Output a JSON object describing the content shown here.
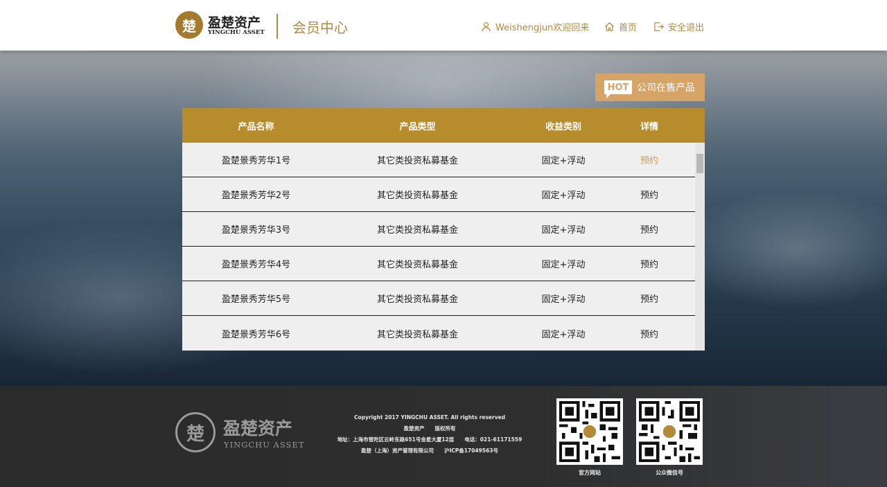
{
  "header": {
    "logo_cn": "盈楚资产",
    "logo_en": "YINGCHU ASSET",
    "title": "会员中心",
    "user_text": "Weishengjun欢迎回来",
    "home_label": "首页",
    "logout_label": "安全退出",
    "accent_color": "#b48a3a"
  },
  "hot": {
    "badge": "HOT",
    "label": "公司在售产品",
    "color": "#d6a467"
  },
  "table": {
    "header_color": "#b78c2d",
    "columns": [
      "产品名称",
      "产品类型",
      "收益类别",
      "详情"
    ],
    "rows": [
      {
        "name": "盈楚景秀芳华1号",
        "type": "其它类投资私募基金",
        "income": "固定+浮动",
        "action": "预约"
      },
      {
        "name": "盈楚景秀芳华2号",
        "type": "其它类投资私募基金",
        "income": "固定+浮动",
        "action": "预约"
      },
      {
        "name": "盈楚景秀芳华3号",
        "type": "其它类投资私募基金",
        "income": "固定+浮动",
        "action": "预约"
      },
      {
        "name": "盈楚景秀芳华4号",
        "type": "其它类投资私募基金",
        "income": "固定+浮动",
        "action": "预约"
      },
      {
        "name": "盈楚景秀芳华5号",
        "type": "其它类投资私募基金",
        "income": "固定+浮动",
        "action": "预约"
      },
      {
        "name": "盈楚景秀芳华6号",
        "type": "其它类投资私募基金",
        "income": "固定+浮动",
        "action": "预约"
      }
    ]
  },
  "footer": {
    "logo_cn": "盈楚资产",
    "logo_en": "YINGCHU ASSET",
    "copyright": "Copyright 2017 YINGCHU ASSET. All rights reserved",
    "rights": "盈楚资产　　版权所有",
    "address": "地址：上海市普陀区云岭东路651号金星大厦12层　　电话：021-61171559",
    "company": "盈楚（上海）资产管理有限公司　　沪ICP备17049563号",
    "qr1_label": "官方网站",
    "qr2_label": "公众微信号"
  }
}
